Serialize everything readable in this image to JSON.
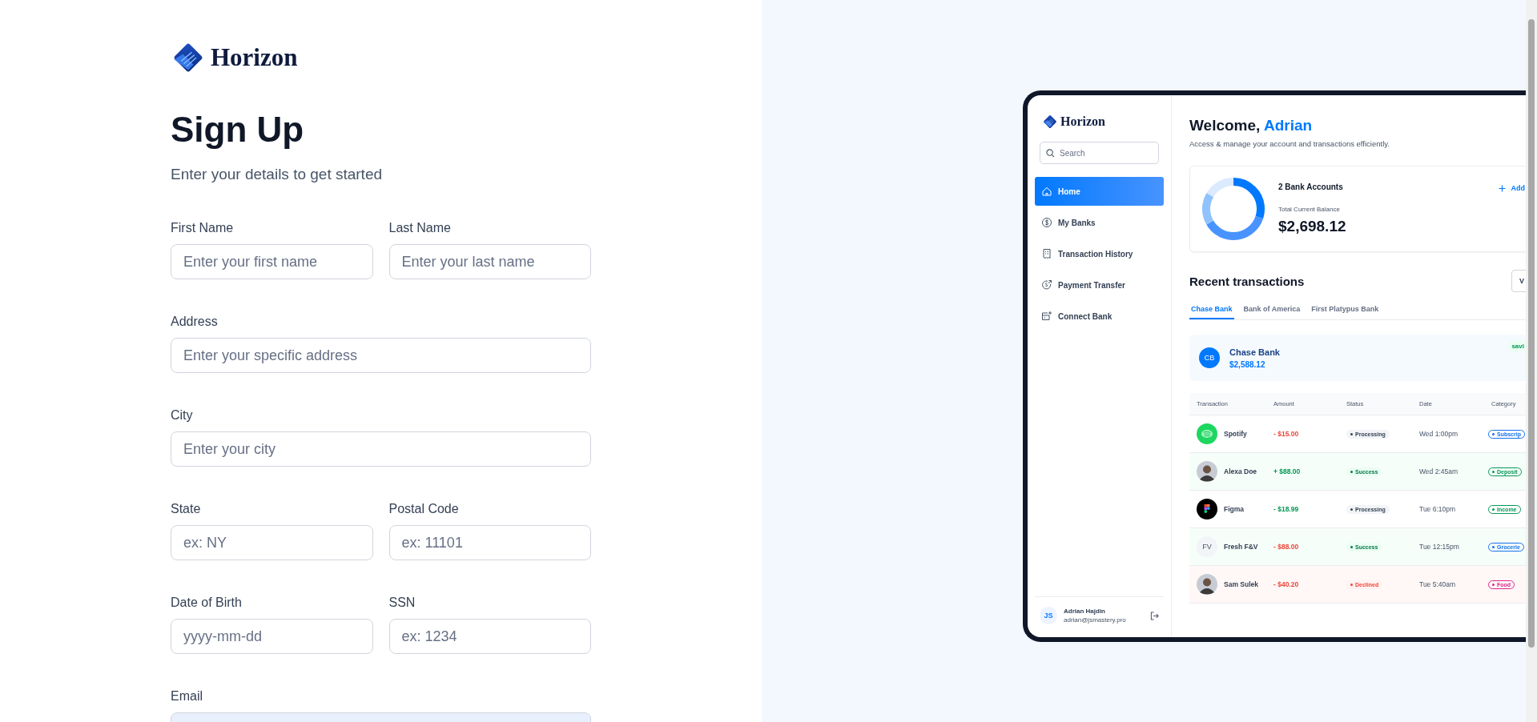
{
  "signup": {
    "brand": "Horizon",
    "title": "Sign Up",
    "subtitle": "Enter your details to get started",
    "field_rows": [
      [
        {
          "label": "First Name",
          "placeholder": "Enter your first name"
        },
        {
          "label": "Last Name",
          "placeholder": "Enter your last name"
        }
      ],
      [
        {
          "label": "Address",
          "placeholder": "Enter your specific address"
        }
      ],
      [
        {
          "label": "City",
          "placeholder": "Enter your city"
        }
      ],
      [
        {
          "label": "State",
          "placeholder": "ex: NY"
        },
        {
          "label": "Postal Code",
          "placeholder": "ex: 11101"
        }
      ],
      [
        {
          "label": "Date of Birth",
          "placeholder": "yyyy-mm-dd"
        },
        {
          "label": "SSN",
          "placeholder": "ex: 1234"
        }
      ],
      [
        {
          "label": "Email",
          "autofilled": true
        }
      ]
    ]
  },
  "preview": {
    "sidebar": {
      "brand": "Horizon",
      "search": {
        "placeholder": "Search"
      },
      "nav": [
        {
          "label": "Home",
          "selected": true
        },
        {
          "label": "My Banks",
          "selected": false
        },
        {
          "label": "Transaction History",
          "selected": false
        },
        {
          "label": "Payment Transfer",
          "selected": false
        },
        {
          "label": "Connect Bank",
          "selected": false
        }
      ],
      "user": {
        "logo_text": "JS",
        "name": "Adrian Hajdin",
        "email": "adrian@jsmastery.pro"
      }
    },
    "header": {
      "greeting": "Welcome,",
      "name": "Adrian",
      "subtitle": "Access & manage your account and transactions efficiently."
    },
    "balance": {
      "accounts": "2 Bank Accounts",
      "add_link": "Add",
      "total_label": "Total Current Balance",
      "total": "$2,698.12"
    },
    "recent": {
      "title": "Recent transactions",
      "view_button": "V",
      "tabs": [
        {
          "label": "Chase Bank",
          "selected": true
        },
        {
          "label": "Bank of America",
          "selected": false
        },
        {
          "label": "First Platypus Bank",
          "selected": false
        }
      ],
      "bank": {
        "initials": "CB",
        "name": "Chase Bank",
        "balance": "$2,588.12",
        "badge": "savi"
      },
      "columns": [
        "Transaction",
        "Amount",
        "Status",
        "Date",
        "Category"
      ],
      "rows": [
        {
          "avatar": {
            "kind": "waves"
          },
          "name": "Spotify",
          "amount": {
            "text": "- $15.00",
            "positive": false
          },
          "status": {
            "label": "Processing",
            "kind": "processing"
          },
          "date": "Wed 1:00pm",
          "category": {
            "label": "Subscrip",
            "color": "#1570ef"
          }
        },
        {
          "avatar": {
            "kind": "person"
          },
          "name": "Alexa Doe",
          "amount": {
            "text": "+ $88.00",
            "positive": true
          },
          "status": {
            "label": "Success",
            "kind": "success"
          },
          "date": "Wed 2:45am",
          "category": {
            "label": "Deposit",
            "color": "#039855"
          }
        },
        {
          "avatar": {
            "kind": "shapes"
          },
          "name": "Figma",
          "amount": {
            "text": "- $18.99",
            "positive": true
          },
          "status": {
            "label": "Processing",
            "kind": "processing"
          },
          "date": "Tue 6:10pm",
          "category": {
            "label": "Income",
            "color": "#039855"
          }
        },
        {
          "avatar": {
            "kind": "initials",
            "text": "FV"
          },
          "name": "Fresh F&V",
          "amount": {
            "text": "- $88.00",
            "positive": false
          },
          "status": {
            "label": "Success",
            "kind": "success"
          },
          "date": "Tue 12:15pm",
          "category": {
            "label": "Grocerie",
            "color": "#1570ef"
          }
        },
        {
          "avatar": {
            "kind": "person"
          },
          "name": "Sam Sulek",
          "amount": {
            "text": "- $40.20",
            "positive": false
          },
          "status": {
            "label": "Declined",
            "kind": "declined"
          },
          "date": "Tue 5:40am",
          "category": {
            "label": "Food",
            "color": "#dd2590"
          }
        }
      ]
    }
  }
}
